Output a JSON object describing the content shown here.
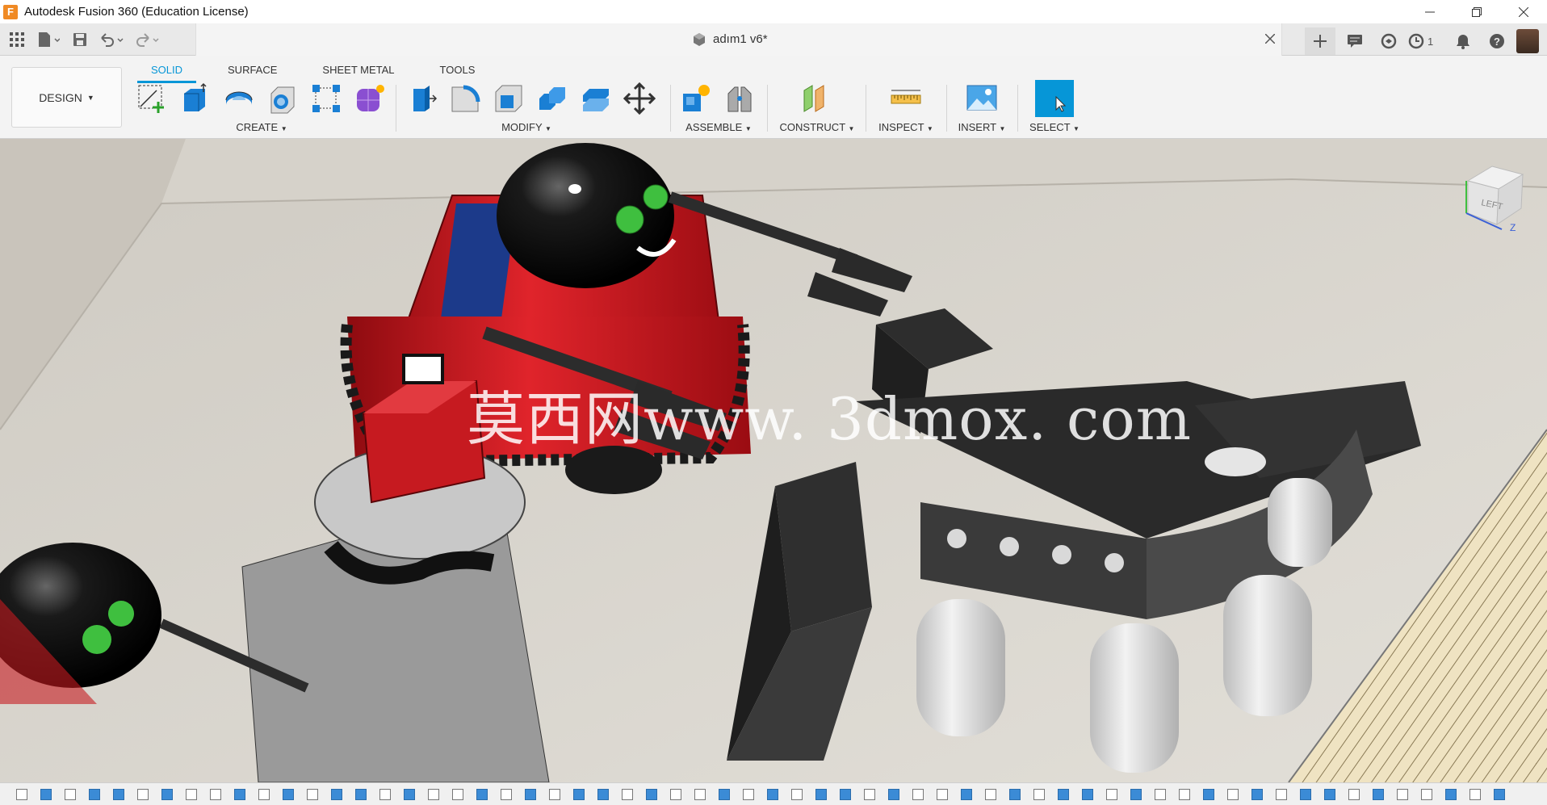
{
  "window": {
    "title": "Autodesk Fusion 360 (Education License)",
    "app_logo": "F"
  },
  "document": {
    "title": "adım1 v6*"
  },
  "appbar": {
    "job_count": "1"
  },
  "ribbon": {
    "workspace": "DESIGN",
    "tabs": [
      "SOLID",
      "SURFACE",
      "SHEET METAL",
      "TOOLS"
    ],
    "active_tab": "SOLID",
    "groups": {
      "create": "CREATE",
      "modify": "MODIFY",
      "assemble": "ASSEMBLE",
      "construct": "CONSTRUCT",
      "inspect": "INSPECT",
      "insert": "INSERT",
      "select": "SELECT"
    }
  },
  "viewport": {
    "watermark": "莫西网www. 3dmox. com",
    "viewcube_face": "LEFT",
    "viewcube_axis": "Z"
  },
  "colors": {
    "accent": "#0696d7",
    "robot_red": "#c8161d",
    "floor": "#d8d4cc"
  },
  "icons": {
    "window": [
      "minimize-icon",
      "restore-icon",
      "close-icon"
    ],
    "appbar": [
      "apps-grid-icon",
      "file-icon",
      "save-icon",
      "undo-icon",
      "redo-icon",
      "new-tab-icon",
      "chat-icon",
      "globe-icon",
      "clock-icon",
      "bell-icon",
      "help-icon"
    ]
  }
}
